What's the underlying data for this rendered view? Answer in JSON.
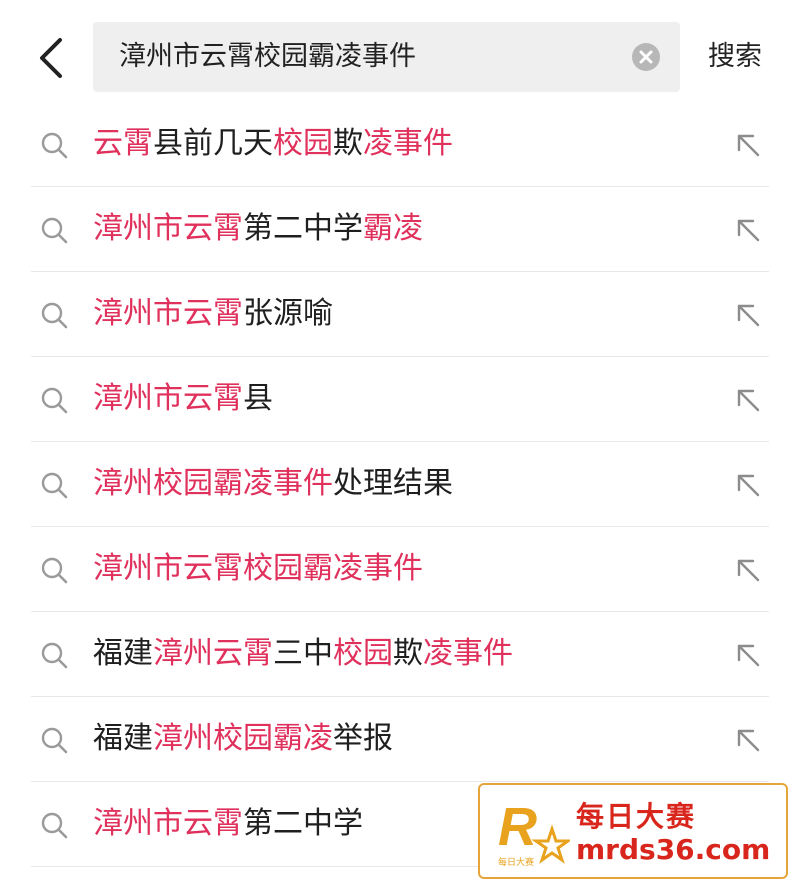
{
  "header": {
    "query": "漳州市云霄校园霸凌事件",
    "search_label": "搜索"
  },
  "colors": {
    "highlight": "#e0315c",
    "text": "#1f1f1f",
    "ad_red": "#d9261c",
    "ad_border": "#e6a53b"
  },
  "suggestions": [
    {
      "segments": [
        {
          "text": "云霄",
          "hl": true
        },
        {
          "text": "县前几天",
          "hl": false
        },
        {
          "text": "校园",
          "hl": true
        },
        {
          "text": "欺",
          "hl": false
        },
        {
          "text": "凌事件",
          "hl": true
        }
      ]
    },
    {
      "segments": [
        {
          "text": "漳州市云霄",
          "hl": true
        },
        {
          "text": "第二中学",
          "hl": false
        },
        {
          "text": "霸凌",
          "hl": true
        }
      ]
    },
    {
      "segments": [
        {
          "text": "漳州市云霄",
          "hl": true
        },
        {
          "text": "张源喻",
          "hl": false
        }
      ]
    },
    {
      "segments": [
        {
          "text": "漳州市云霄",
          "hl": true
        },
        {
          "text": "县",
          "hl": false
        }
      ]
    },
    {
      "segments": [
        {
          "text": "漳州校园霸凌事件",
          "hl": true
        },
        {
          "text": "处理结果",
          "hl": false
        }
      ]
    },
    {
      "segments": [
        {
          "text": "漳州市云霄校园霸凌事件",
          "hl": true
        }
      ]
    },
    {
      "segments": [
        {
          "text": "福建",
          "hl": false
        },
        {
          "text": "漳州云霄",
          "hl": true
        },
        {
          "text": "三中",
          "hl": false
        },
        {
          "text": "校园",
          "hl": true
        },
        {
          "text": "欺",
          "hl": false
        },
        {
          "text": "凌事件",
          "hl": true
        }
      ]
    },
    {
      "segments": [
        {
          "text": "福建",
          "hl": false
        },
        {
          "text": "漳州校园霸凌",
          "hl": true
        },
        {
          "text": "举报",
          "hl": false
        }
      ]
    },
    {
      "segments": [
        {
          "text": "漳州市云霄",
          "hl": true
        },
        {
          "text": "第二中学",
          "hl": false
        }
      ]
    }
  ],
  "watermark": {
    "logo_letter": "R",
    "logo_caption": "每日大赛",
    "title": "每日大赛",
    "url": "mrds36.com"
  }
}
